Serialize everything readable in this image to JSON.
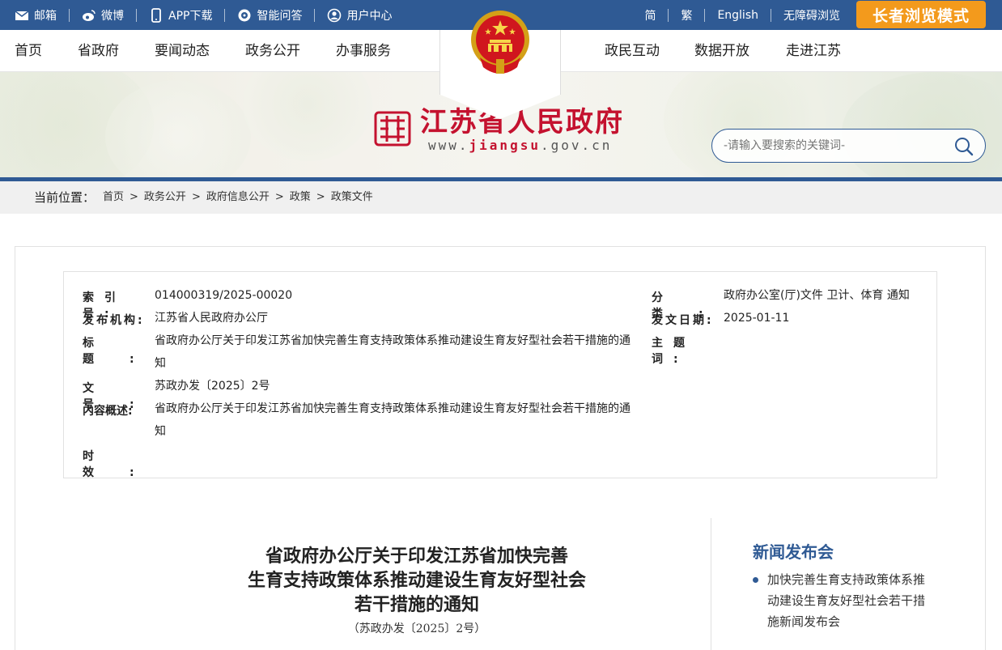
{
  "topbar": {
    "left_items": [
      {
        "label": "邮箱",
        "icon": "mail-icon"
      },
      {
        "label": "微博",
        "icon": "weibo-icon"
      },
      {
        "label": "APP下载",
        "icon": "phone-icon"
      },
      {
        "label": "智能问答",
        "icon": "chat-icon"
      },
      {
        "label": "用户中心",
        "icon": "user-icon"
      }
    ],
    "right_items": [
      "简",
      "繁",
      "English",
      "无障碍浏览"
    ],
    "elder_mode": "长者浏览模式"
  },
  "nav": {
    "left": [
      "首页",
      "省政府",
      "要闻动态",
      "政务公开",
      "办事服务"
    ],
    "right": [
      "政民互动",
      "数据开放",
      "走进江苏"
    ]
  },
  "site": {
    "title": "江苏省人民政府",
    "url_prefix": "www.",
    "url_mid": "jiangsu",
    "url_suffix": ".gov.cn"
  },
  "search": {
    "placeholder": "-请输入要搜索的关键词-"
  },
  "breadcrumb": {
    "label": "当前位置：",
    "items": [
      "首页",
      "政务公开",
      "政府信息公开",
      "政策",
      "政策文件"
    ],
    "separator": ">"
  },
  "meta": {
    "index_no": {
      "key": "索引号:",
      "value": "014000319/2025-00020"
    },
    "publisher": {
      "key": "发布机构:",
      "value": "江苏省人民政府办公厅"
    },
    "title": {
      "key": "标题:",
      "value": "省政府办公厅关于印发江苏省加快完善生育支持政策体系推动建设生育友好型社会若干措施的通知"
    },
    "doc_no": {
      "key": "文号:",
      "value": "苏政办发〔2025〕2号"
    },
    "summary": {
      "key": "内容概述:",
      "value": "省政府办公厅关于印发江苏省加快完善生育支持政策体系推动建设生育友好型社会若干措施的通知"
    },
    "validity": {
      "key": "时效:",
      "value": ""
    },
    "category": {
      "key": "分类:",
      "value": "政府办公室(厅)文件 卫计、体育 通知"
    },
    "date": {
      "key": "发文日期:",
      "value": "2025-01-11"
    },
    "keywords": {
      "key": "主题词:",
      "value": ""
    }
  },
  "document": {
    "title_lines": [
      "省政府办公厅关于印发江苏省加快完善",
      "生育支持政策体系推动建设生育友好型社会",
      "若干措施的通知"
    ],
    "number": "（苏政办发〔2025〕2号）"
  },
  "sidebar": {
    "title": "新闻发布会",
    "items": [
      "加快完善生育支持政策体系推动建设生育友好型社会若干措施新闻发布会"
    ]
  },
  "colors": {
    "primary": "#2f5a94",
    "accent": "#f39a1c",
    "brand_red": "#c4122f"
  }
}
